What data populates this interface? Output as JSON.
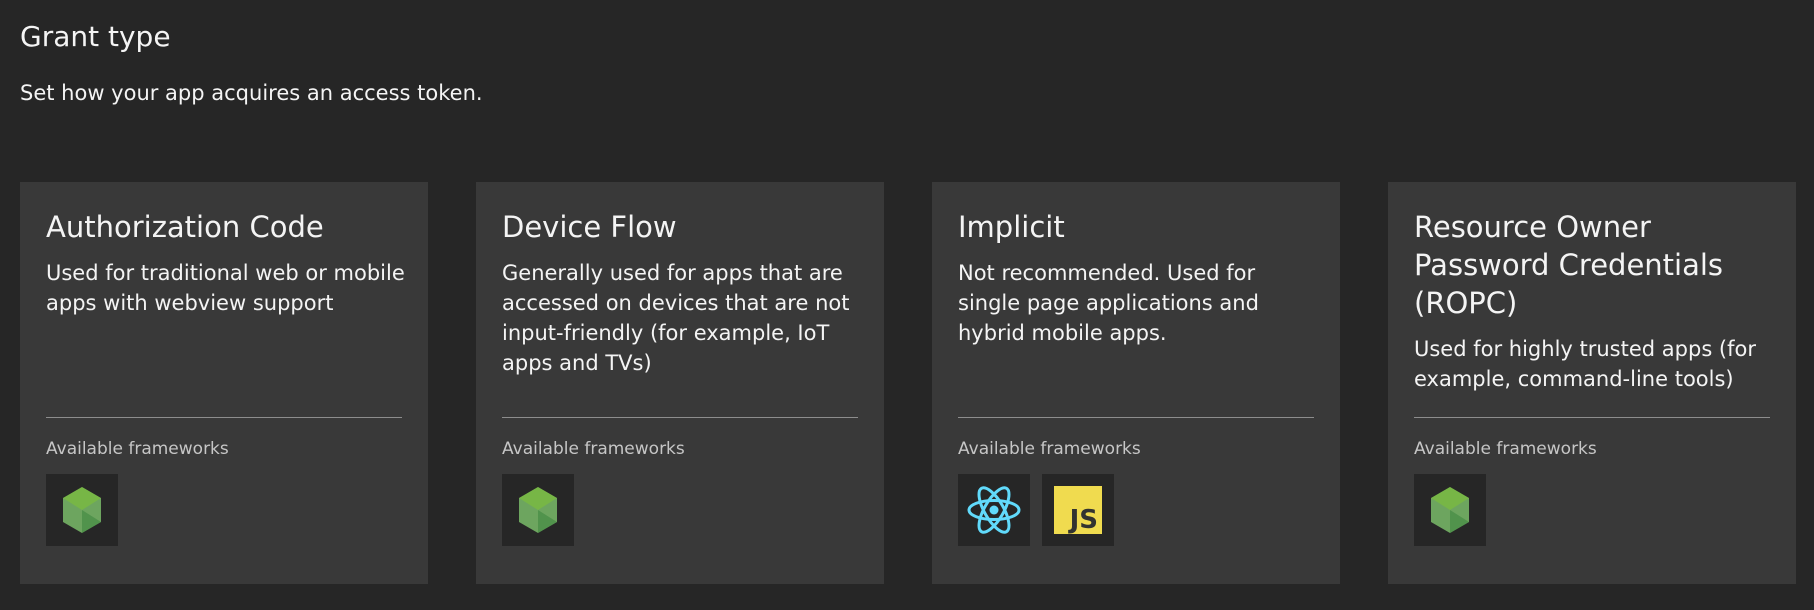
{
  "header": {
    "title": "Grant type",
    "subtitle": "Set how your app acquires an access token."
  },
  "cards": [
    {
      "title": "Authorization Code",
      "description": "Used for traditional web or mobile apps with webview support",
      "frameworks_label": "Available frameworks",
      "frameworks": [
        "nodejs-icon"
      ]
    },
    {
      "title": "Device Flow",
      "description": "Generally used for apps that are accessed on devices that are not input-friendly (for example, IoT apps and TVs)",
      "frameworks_label": "Available frameworks",
      "frameworks": [
        "nodejs-icon"
      ]
    },
    {
      "title": "Implicit",
      "description": "Not recommended. Used for single page applications and hybrid mobile apps.",
      "frameworks_label": "Available frameworks",
      "frameworks": [
        "react-icon",
        "javascript-icon"
      ]
    },
    {
      "title": "Resource Owner Password Credentials (ROPC)",
      "description": "Used for highly trusted apps (for example, command-line tools)",
      "frameworks_label": "Available frameworks",
      "frameworks": [
        "nodejs-icon"
      ]
    }
  ],
  "icons": {
    "js_text": "JS"
  },
  "colors": {
    "background": "#262626",
    "card": "#393939",
    "node_green": "#6da55f",
    "react_blue": "#61dafb",
    "js_yellow": "#f0db4f"
  }
}
